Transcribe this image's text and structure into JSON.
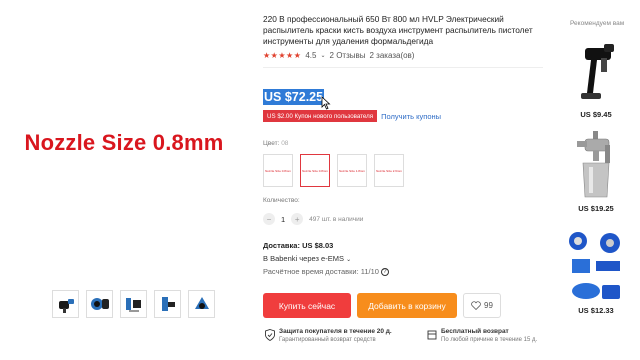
{
  "gallery": {
    "main_caption": "Nozzle Size 0.8mm",
    "thumbnails": [
      "thumb-1",
      "thumb-2",
      "thumb-3",
      "thumb-4",
      "thumb-5"
    ]
  },
  "product": {
    "title": "220 В профессиональный 650 Вт 800 мл HVLP Электрический распылитель краски кисть воздуха инструмент распылитель пистолет инструменты для удаления формальдегида",
    "rating": "4.5",
    "reviews": "2 Отзывы",
    "orders": "2 заказа(ов)",
    "price": "US $72.25",
    "coupon_badge": "US $2.00 Купон нового пользователя",
    "coupon_link": "Получить купоны",
    "color_label": "Цвет:",
    "color_value": "08",
    "swatches": [
      "Nozzle Size 0.8mm",
      "Nozzle Size 0.8mm",
      "Nozzle Size 1.8mm",
      "Nozzle Size 2.6mm"
    ],
    "selected_swatch_index": 1,
    "quantity_label": "Количество:",
    "quantity": "1",
    "minus": "−",
    "plus": "+",
    "stock": "497 шт. в наличии",
    "delivery_label": "Доставка:",
    "delivery_cost": "US $8.03",
    "delivery_via": "В Babenki через e-EMS",
    "delivery_time": "Расчётное время доставки: 11/10",
    "buy_now": "Купить сейчас",
    "add_to_cart": "Добавить в корзину",
    "wishlist_count": "99",
    "guarantee_1_title": "Защита покупателя в течение 20 д.",
    "guarantee_1_sub": "Гарантированный возврат средств",
    "guarantee_2_title": "Бесплатный возврат",
    "guarantee_2_sub": "По любой причине в течение 15 д."
  },
  "recommendations": {
    "title": "Рекомендуем вам",
    "items": [
      {
        "price": "US $9.45",
        "icon": "spray-gun-icon"
      },
      {
        "price": "US $19.25",
        "icon": "spray-gun-icon"
      },
      {
        "price": "US $12.33",
        "icon": "turbo-parts-icon"
      }
    ]
  },
  "colors": {
    "price_highlight": "#2f7bd7",
    "coupon": "#e0373f",
    "buy_now": "#f03d3d",
    "add_to_cart": "#f78d1c",
    "nozzle_text": "#d9161e"
  }
}
